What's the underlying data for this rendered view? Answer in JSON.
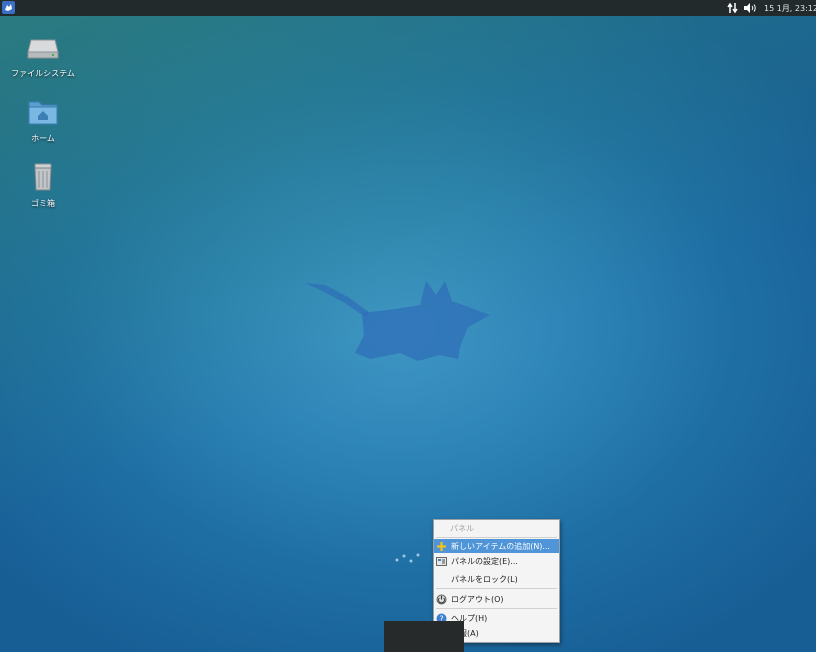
{
  "top_panel": {
    "clock": "15 1月, 23:12",
    "icons": [
      "app-menu-icon",
      "network-icon",
      "volume-icon"
    ]
  },
  "desktop": {
    "icons": [
      {
        "label": "ファイルシステム",
        "icon": "drive-icon"
      },
      {
        "label": "ホーム",
        "icon": "home-folder-icon"
      },
      {
        "label": "ゴミ箱",
        "icon": "trash-icon"
      }
    ]
  },
  "context_menu": {
    "title": "パネル",
    "items": [
      {
        "label": "新しいアイテムの追加(N)...",
        "icon": "add-icon",
        "selected": true
      },
      {
        "label": "パネルの設定(E)...",
        "icon": "panel-settings-icon"
      },
      {
        "label": "パネルをロック(L)",
        "icon": ""
      },
      {
        "label": "ログアウト(O)",
        "icon": "logout-icon"
      },
      {
        "label": "ヘルプ(H)",
        "icon": "help-icon"
      },
      {
        "label": "情報(A)",
        "icon": "about-icon"
      }
    ]
  },
  "colors": {
    "panel_bg": "#222a2c",
    "menu_highlight": "#4f95d8",
    "desktop_blue": "#2a80b3"
  }
}
